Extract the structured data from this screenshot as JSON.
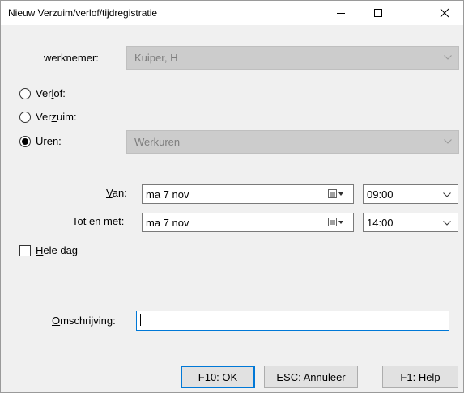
{
  "window": {
    "title": "Nieuw Verzuim/verlof/tijdregistratie"
  },
  "employee": {
    "label": "werknemer:",
    "value": "Kuiper, H"
  },
  "types": {
    "leave": {
      "label_pre": "Ver",
      "label_u": "l",
      "label_post": "of:",
      "selected": false
    },
    "absence": {
      "label_pre": "Ver",
      "label_u": "z",
      "label_post": "uim:",
      "selected": false
    },
    "hours": {
      "label_pre": "",
      "label_u": "U",
      "label_post": "ren:",
      "selected": true,
      "value": "Werkuren"
    }
  },
  "from": {
    "label_u": "V",
    "label_post": "an:",
    "date": "ma   7 nov",
    "time": "09:00"
  },
  "to": {
    "label_u": "T",
    "label_post": "ot en met:",
    "date": "ma   7 nov",
    "time": "14:00"
  },
  "all_day": {
    "label_u": "H",
    "label_post": "ele dag",
    "checked": false
  },
  "description": {
    "label_u": "O",
    "label_post": "mschrijving:",
    "value": ""
  },
  "buttons": {
    "ok": "F10: OK",
    "cancel": "ESC: Annuleer",
    "help": "F1: Help"
  }
}
